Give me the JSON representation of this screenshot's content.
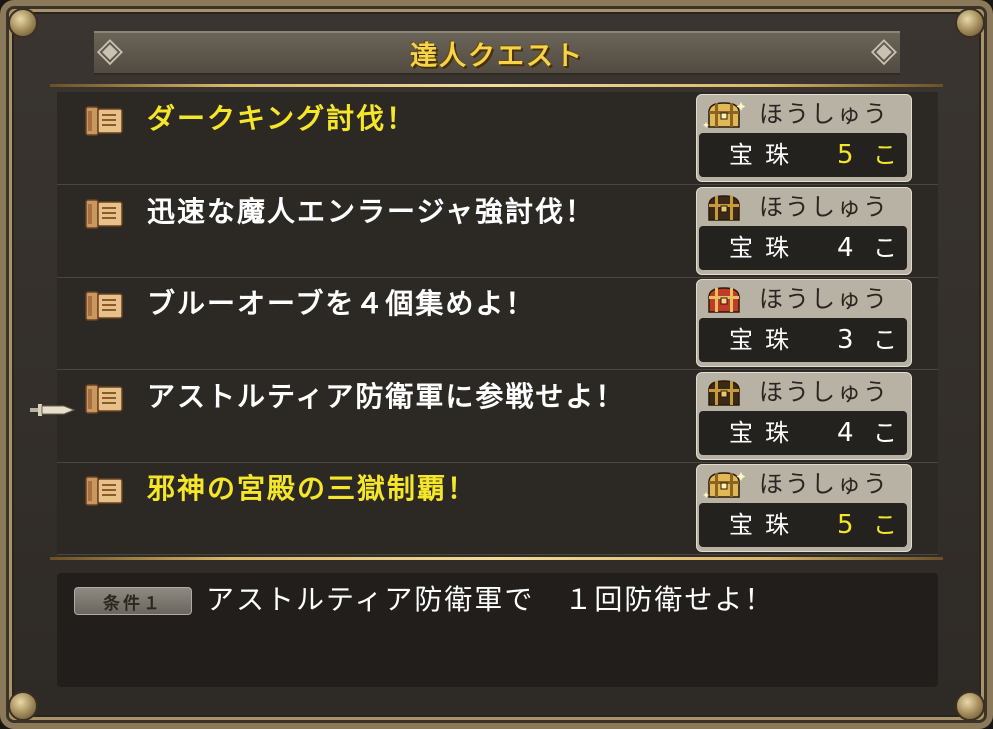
{
  "window": {
    "title": "達人クエスト"
  },
  "colors": {
    "highlight_yellow": "#f5e62a",
    "normal_text": "#ffffff",
    "title_gold": "#f5d44a"
  },
  "quests": [
    {
      "title": "ダークキング討伐！",
      "highlighted": true,
      "icon": "quest-scroll-icon",
      "reward": {
        "label": "ほうしゅう",
        "item": "宝珠",
        "count": "5",
        "unit": "こ",
        "chest": "gold-chest-icon"
      }
    },
    {
      "title": "迅速な魔人エンラージャ強討伐！",
      "highlighted": false,
      "icon": "quest-scroll-icon",
      "reward": {
        "label": "ほうしゅう",
        "item": "宝珠",
        "count": "4",
        "unit": "こ",
        "chest": "black-chest-icon"
      }
    },
    {
      "title": "ブルーオーブを４個集めよ！",
      "highlighted": false,
      "icon": "quest-scroll-icon",
      "reward": {
        "label": "ほうしゅう",
        "item": "宝珠",
        "count": "3",
        "unit": "こ",
        "chest": "red-chest-icon"
      }
    },
    {
      "title": "アストルティア防衛軍に参戦せよ！",
      "highlighted": false,
      "icon": "quest-scroll-icon",
      "reward": {
        "label": "ほうしゅう",
        "item": "宝珠",
        "count": "4",
        "unit": "こ",
        "chest": "black-chest-icon"
      }
    },
    {
      "title": "邪神の宮殿の三獄制覇！",
      "highlighted": true,
      "icon": "quest-scroll-icon",
      "reward": {
        "label": "ほうしゅう",
        "item": "宝珠",
        "count": "5",
        "unit": "こ",
        "chest": "gold-chest-icon"
      }
    }
  ],
  "selected_index": 3,
  "condition": {
    "badge": "条件１",
    "text": "アストルティア防衛軍で　１回防衛せよ！"
  }
}
